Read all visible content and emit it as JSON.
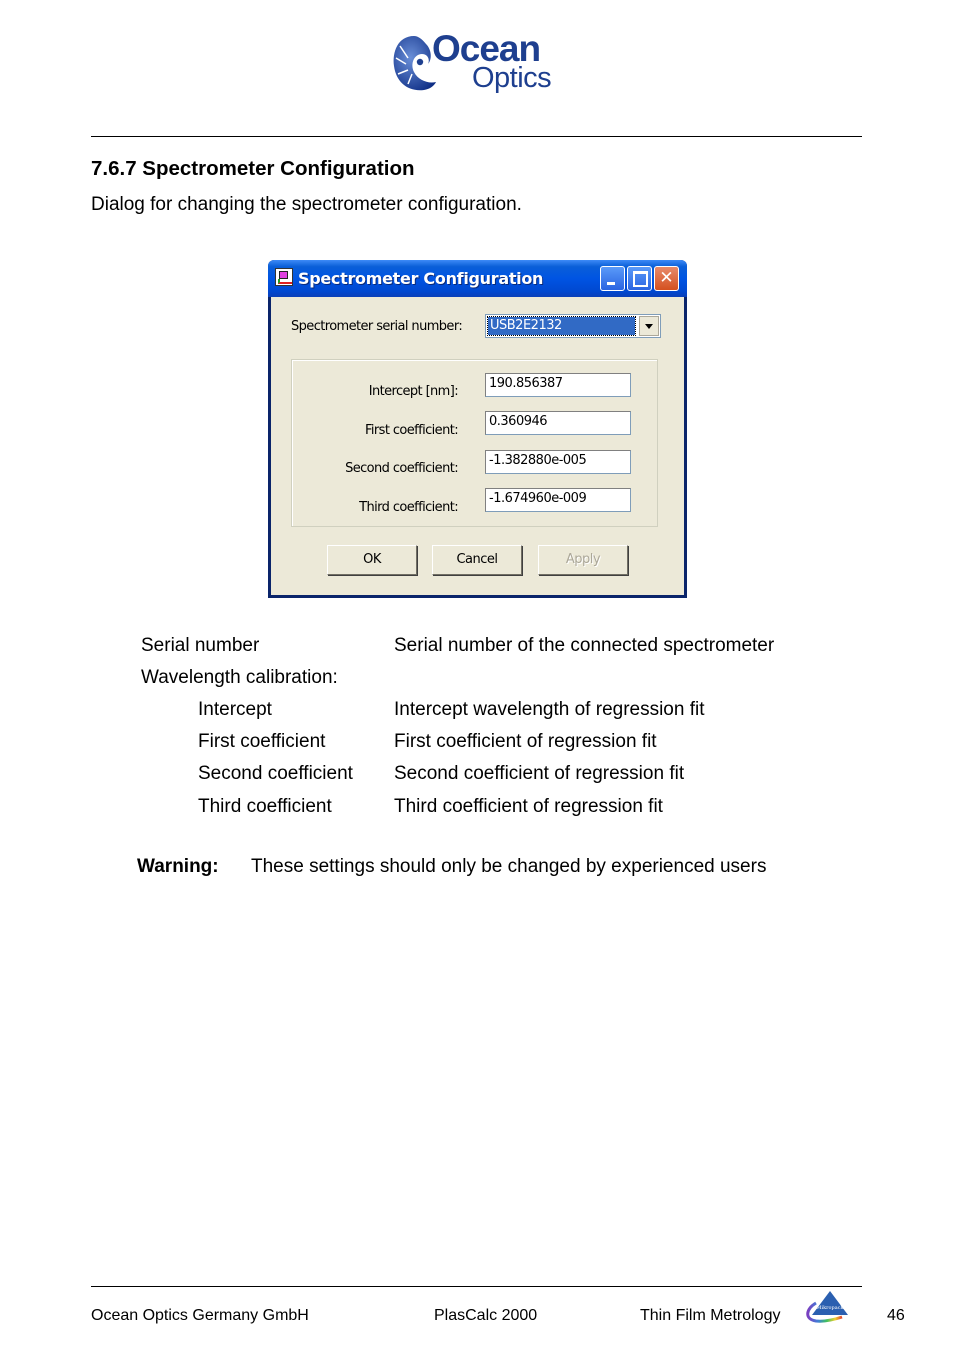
{
  "header": {
    "logo": {
      "line1": "Ocean",
      "line2": "Optics",
      "icon": "ocean-optics-nautilus-logo"
    }
  },
  "section": {
    "title": "7.6.7 Spectrometer Configuration",
    "description": "Dialog for changing the spectrometer configuration."
  },
  "dialog": {
    "title": "Spectrometer Configuration",
    "title_icon": "app-icon",
    "window_buttons": {
      "minimize": "minimize-icon",
      "maximize": "maximize-icon",
      "close": "✕"
    },
    "serial_label": "Spectrometer serial number:",
    "serial_value": "USB2E2132",
    "fields": [
      {
        "label": "Intercept [nm]:",
        "value": "190.856387"
      },
      {
        "label": "First coefficient:",
        "value": "0.360946"
      },
      {
        "label": "Second coefficient:",
        "value": "-1.382880e-005"
      },
      {
        "label": "Third coefficient:",
        "value": "-1.674960e-009"
      }
    ],
    "buttons": {
      "ok": "OK",
      "cancel": "Cancel",
      "apply": "Apply"
    }
  },
  "definitions": [
    {
      "term": "Serial number",
      "def": "Serial number of the connected spectrometer"
    },
    {
      "term": "Wavelength calibration:",
      "def": ""
    },
    {
      "term": "Intercept",
      "def": "Intercept wavelength of regression fit"
    },
    {
      "term": "First coefficient",
      "def": "First coefficient of regression fit"
    },
    {
      "term": "Second coefficient",
      "def": "Second coefficient of regression fit"
    },
    {
      "term": "Third coefficient",
      "def": "Third coefficient of regression fit"
    }
  ],
  "warning": {
    "label": "Warning:",
    "text": "These settings should only be changed by experienced users"
  },
  "footer": {
    "company": "Ocean Optics Germany GmbH",
    "product": "PlasCalc 2000",
    "topic": "Thin Film Metrology",
    "partner_logo_text": "Mikropack",
    "page_number": "46"
  }
}
